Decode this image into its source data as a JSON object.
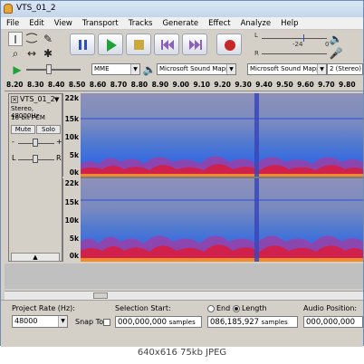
{
  "window": {
    "title": "VTS_01_2"
  },
  "menu": [
    "File",
    "Edit",
    "View",
    "Transport",
    "Tracks",
    "Generate",
    "Effect",
    "Analyze",
    "Help"
  ],
  "meters": {
    "left_label": "L",
    "right_label": "R",
    "ticks": [
      "-24",
      "0",
      "-24",
      "0"
    ]
  },
  "devices": {
    "host": "MME",
    "output": "Microsoft Sound Mappe",
    "input": "Microsoft Sound Mappe",
    "channels": "2 (Stereo) I"
  },
  "ruler": [
    "8.20",
    "8.30",
    "8.40",
    "8.50",
    "8.60",
    "8.70",
    "8.80",
    "8.90",
    "9.00",
    "9.10",
    "9.20",
    "9.30",
    "9.40",
    "9.50",
    "9.60",
    "9.70",
    "9.80"
  ],
  "track": {
    "name": "VTS_01_2",
    "info1": "Stereo, 48000Hz",
    "info2": "16-bit PCM",
    "mute": "Mute",
    "solo": "Solo",
    "l": "L",
    "r": "R",
    "minus": "-",
    "plus": "+",
    "collapse": "▲",
    "scale": [
      "22k",
      "15k",
      "10k",
      "5k",
      "0k"
    ]
  },
  "selection": {
    "project_rate_label": "Project Rate (Hz):",
    "project_rate": "48000",
    "snap_to_label": "Snap To",
    "selection_start_label": "Selection Start:",
    "start_value": "000,000,000",
    "start_unit": "samples",
    "end_label": "End",
    "length_label": "Length",
    "length_value": "086,185,927",
    "length_unit": "samples",
    "audio_position_label": "Audio Position:",
    "audio_position_value": "000,000,000"
  },
  "caption": "640x616 75kb JPEG",
  "colors": {
    "spectrogram_top": "#8a8fb8",
    "spectrogram_mid": "#3f6fd6",
    "spectrogram_hot": "#d0204c",
    "title_bar": "#c4d6ec"
  }
}
